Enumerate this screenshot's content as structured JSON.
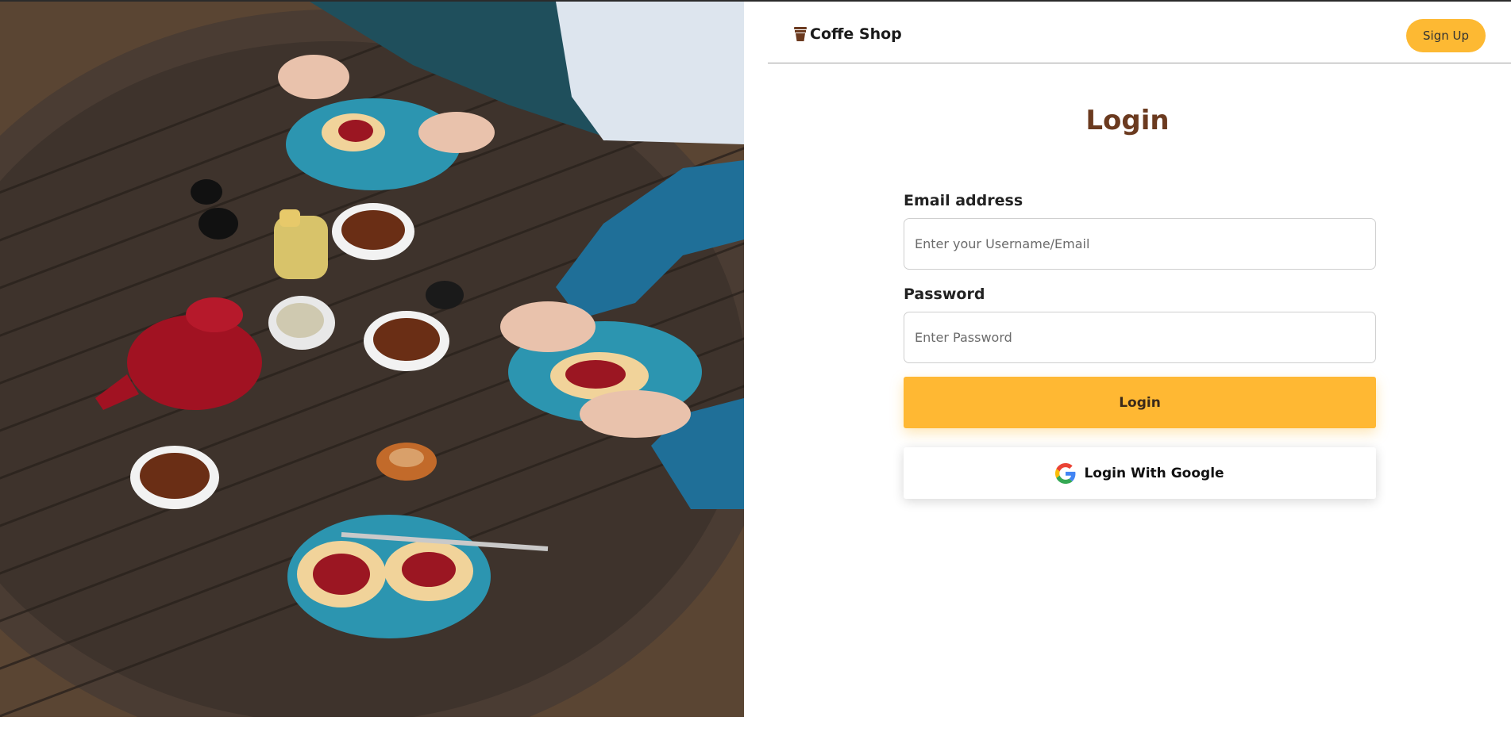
{
  "nav": {
    "brand": "Coffe Shop",
    "brand_icon": "coffee-cup-icon",
    "signup_label": "Sign Up"
  },
  "hero_image": {
    "subject": "photo-coffee-table"
  },
  "login": {
    "title": "Login",
    "email_label": "Email address",
    "email_placeholder": "Enter your Username/Email",
    "email_value": "",
    "password_label": "Password",
    "password_placeholder": "Enter Password",
    "password_value": "",
    "submit_label": "Login",
    "google_label": "Login With Google",
    "google_icon": "google-icon"
  },
  "colors": {
    "accent": "#fdb933",
    "title": "#6b3a1f",
    "text": "#222222"
  }
}
